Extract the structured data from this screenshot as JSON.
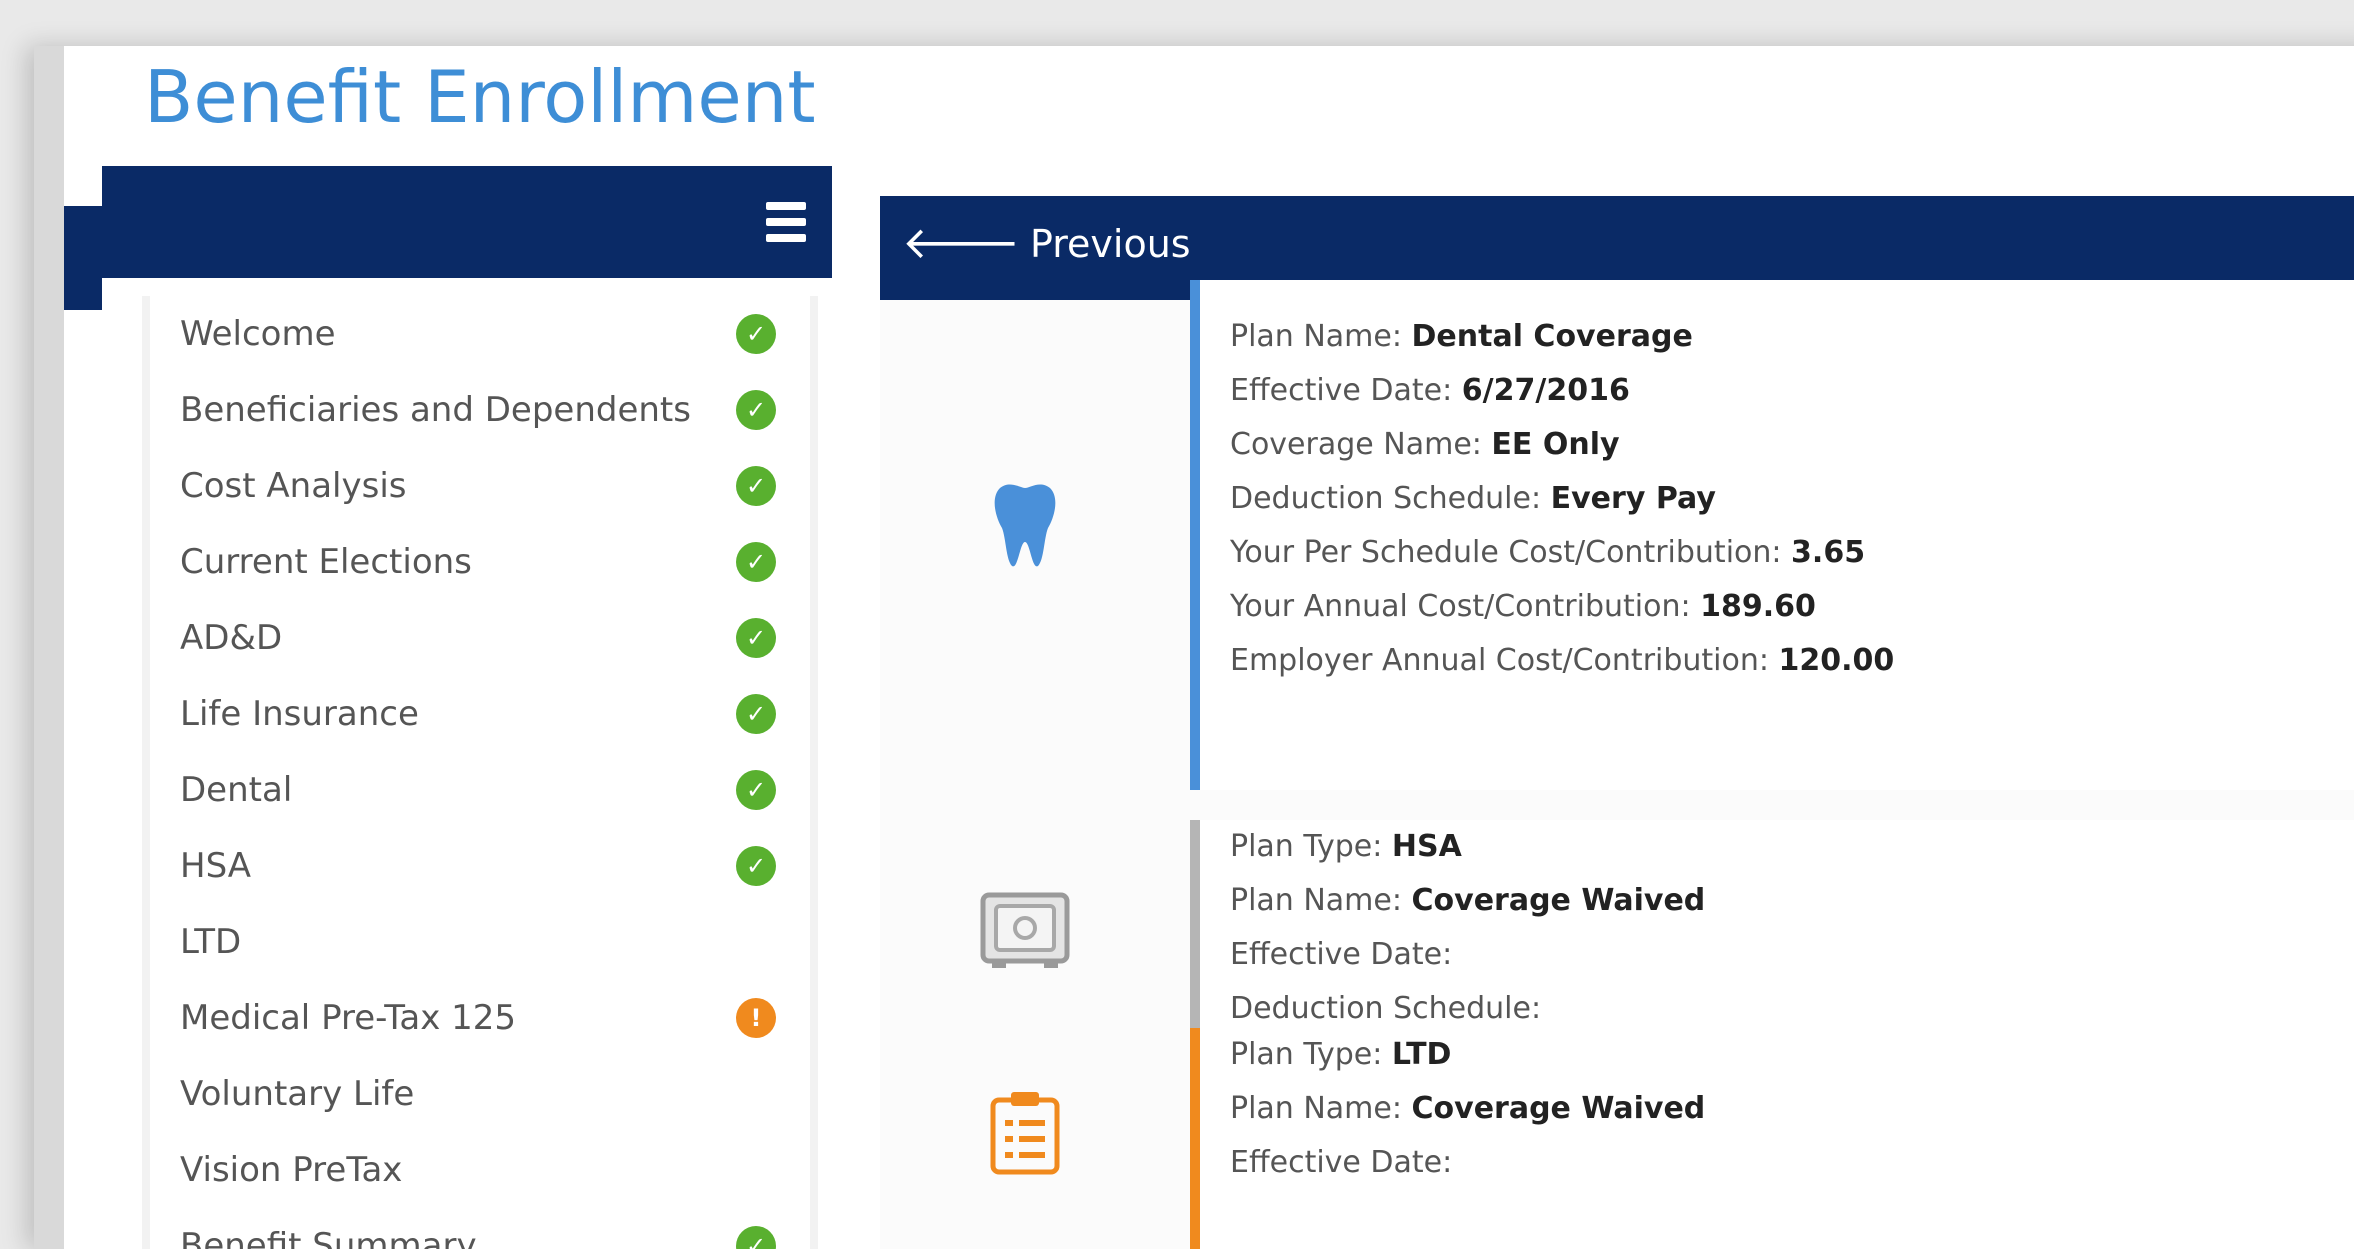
{
  "page": {
    "title": "Benefit Enrollment"
  },
  "sidebar": {
    "items": [
      {
        "label": "Welcome",
        "status": "complete"
      },
      {
        "label": "Beneficiaries and Dependents",
        "status": "complete"
      },
      {
        "label": "Cost Analysis",
        "status": "complete"
      },
      {
        "label": "Current Elections",
        "status": "complete"
      },
      {
        "label": "AD&D",
        "status": "complete"
      },
      {
        "label": "Life Insurance",
        "status": "complete"
      },
      {
        "label": "Dental",
        "status": "complete"
      },
      {
        "label": "HSA",
        "status": "complete"
      },
      {
        "label": "LTD",
        "status": "none"
      },
      {
        "label": "Medical Pre-Tax 125",
        "status": "warning"
      },
      {
        "label": "Voluntary Life",
        "status": "none"
      },
      {
        "label": "Vision PreTax",
        "status": "none"
      },
      {
        "label": "Benefit Summary",
        "status": "complete"
      }
    ],
    "status_glyphs": {
      "complete": "✓",
      "warning": "!",
      "none": ""
    }
  },
  "main": {
    "previous_label": "Previous",
    "plans": [
      {
        "icon": "tooth-icon",
        "accent_color": "#4a90d9",
        "lines": [
          {
            "label": "Plan Name: ",
            "value": "Dental Coverage"
          },
          {
            "label": "Effective Date: ",
            "value": "6/27/2016"
          },
          {
            "label": "Coverage Name: ",
            "value": "EE Only"
          },
          {
            "label": "Deduction Schedule: ",
            "value": "Every Pay"
          },
          {
            "label": "Your Per Schedule Cost/Contribution: ",
            "value": "3.65"
          },
          {
            "label": "Your Annual Cost/Contribution: ",
            "value": "189.60"
          },
          {
            "label": "Employer Annual Cost/Contribution: ",
            "value": "120.00"
          }
        ]
      },
      {
        "icon": "safe-icon",
        "accent_color": "#b5b5b5",
        "lines": [
          {
            "label": "Plan Type: ",
            "value": "HSA"
          },
          {
            "label": "Plan Name: ",
            "value": "Coverage Waived"
          },
          {
            "label": "Effective Date: ",
            "value": ""
          },
          {
            "label": "Deduction Schedule: ",
            "value": ""
          }
        ]
      },
      {
        "icon": "clipboard-icon",
        "accent_color": "#f08a1e",
        "lines": [
          {
            "label": "Plan Type: ",
            "value": "LTD"
          },
          {
            "label": "Plan Name: ",
            "value": "Coverage Waived"
          },
          {
            "label": "Effective Date: ",
            "value": ""
          }
        ]
      }
    ]
  },
  "colors": {
    "title": "#3e8ed6",
    "navbar": "#0a2a66",
    "complete": "#59b02f",
    "warning": "#f08a1e"
  }
}
